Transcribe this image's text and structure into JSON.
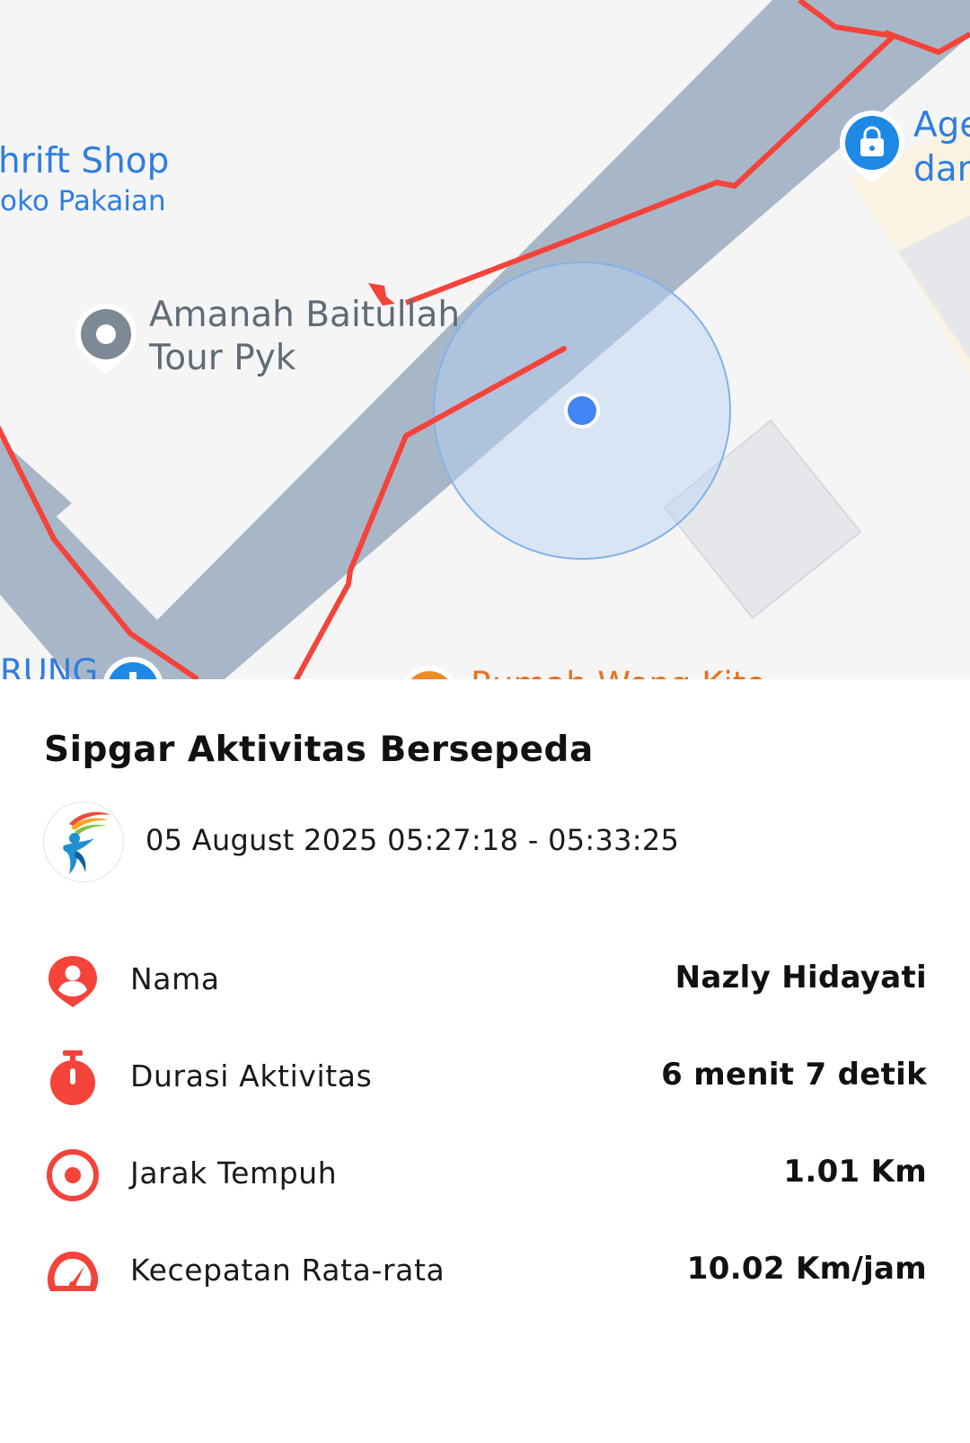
{
  "map": {
    "poi_thrift_name": "hrift Shop",
    "poi_thrift_category": "oko Pakaian",
    "poi_amanah_line1": "Amanah Baitullah",
    "poi_amanah_line2": "Tour Pyk",
    "poi_agen_line1": "Age",
    "poi_agen_line2": "dar",
    "poi_bottom_left": "RUNG",
    "poi_bottom_mid": "Rumah Wong Kito",
    "route_color": "#f4433a",
    "road_color": "#a8b7c8",
    "location_color": "#4285f4"
  },
  "activity": {
    "title": "Sipgar Aktivitas Bersepeda",
    "datetime": "05 August 2025 05:27:18 - 05:33:25",
    "rows": [
      {
        "icon": "person-pin-icon",
        "label": "Nama",
        "value": "Nazly Hidayati"
      },
      {
        "icon": "stopwatch-icon",
        "label": "Durasi Aktivitas",
        "value": "6 menit 7 detik"
      },
      {
        "icon": "target-icon",
        "label": "Jarak Tempuh",
        "value": "1.01 Km"
      },
      {
        "icon": "speedometer-icon",
        "label": "Kecepatan Rata-rata",
        "value": "10.02 Km/jam"
      }
    ],
    "accent_color": "#f4433a"
  }
}
